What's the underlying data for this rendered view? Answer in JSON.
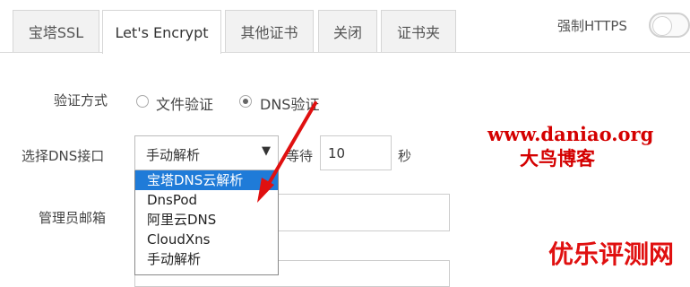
{
  "tabs": [
    {
      "label": "宝塔SSL",
      "active": false
    },
    {
      "label": "Let's Encrypt",
      "active": true
    },
    {
      "label": "其他证书",
      "active": false
    },
    {
      "label": "关闭",
      "active": false
    },
    {
      "label": "证书夹",
      "active": false
    }
  ],
  "https": {
    "label": "强制HTTPS",
    "enabled": false
  },
  "verify": {
    "label": "验证方式",
    "options": [
      {
        "label": "文件验证",
        "checked": false
      },
      {
        "label": "DNS验证",
        "checked": true
      }
    ]
  },
  "dns": {
    "label": "选择DNS接口",
    "selected": "手动解析",
    "wait_label": "等待",
    "wait_value": "10",
    "unit": "秒",
    "options": [
      "宝塔DNS云解析",
      "DnsPod",
      "阿里云DNS",
      "CloudXns",
      "手动解析"
    ],
    "highlighted_index": 0
  },
  "email": {
    "label": "管理员邮箱"
  },
  "watermarks": {
    "site": "www.daniao.org",
    "blog": "大鸟博客",
    "brand": "优乐评测网"
  },
  "colors": {
    "accent": "#1f7bd8",
    "annotation": "#e01010"
  }
}
